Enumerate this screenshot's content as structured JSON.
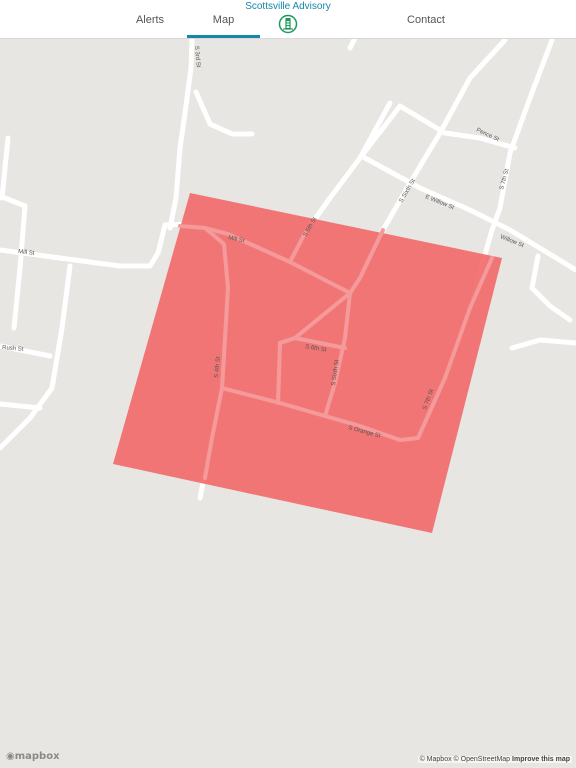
{
  "nav": {
    "tabs": [
      {
        "label": "Alerts"
      },
      {
        "label": "Map"
      },
      {
        "label": "Contact"
      }
    ],
    "brand_title": "Scottsville Advisory",
    "active_color": "#1686a8"
  },
  "map": {
    "streets": {
      "s_3rd": "S 3rd St",
      "mill": "Mill St",
      "mill_2": "Mill St",
      "s_5th": "S 5th St",
      "s_sixth": "S Sixth St",
      "e_willow": "E Willow St",
      "willow": "Willow St",
      "pence": "Pence St",
      "s_7th_top": "S 7th St",
      "rush": "Rush St",
      "s_4th": "S 4th St",
      "s_6th": "S 6th St",
      "s_sixth_lower": "S Sixth St",
      "s_7th": "S 7th St",
      "s_orange": "S Orange St"
    },
    "advisory_zone_color": "#f26b6b"
  },
  "footer": {
    "logo": "mapbox",
    "attribution_mapbox": "© Mapbox",
    "attribution_osm": "© OpenStreetMap",
    "improve": "Improve this map"
  }
}
